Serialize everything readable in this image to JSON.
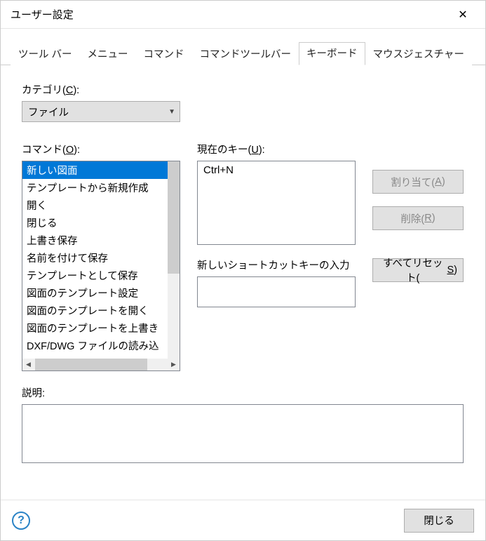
{
  "window": {
    "title": "ユーザー設定"
  },
  "tabs": {
    "t0": "ツール バー",
    "t1": "メニュー",
    "t2": "コマンド",
    "t3": "コマンドツールバー",
    "t4": "キーボード",
    "t5": "マウスジェスチャー"
  },
  "labels": {
    "category_pre": "カテゴリ(",
    "category_key": "C",
    "category_post": "):",
    "commands_pre": "コマンド(",
    "commands_key": "O",
    "commands_post": "):",
    "currentkey_pre": "現在のキー(",
    "currentkey_key": "U",
    "currentkey_post": "):",
    "newshortcut": "新しいショートカットキーの入力",
    "description": "説明:"
  },
  "category": {
    "selected": "ファイル"
  },
  "commands": {
    "items": [
      "新しい図面",
      "テンプレートから新規作成",
      "開く",
      "閉じる",
      "上書き保存",
      "名前を付けて保存",
      "テンプレートとして保存",
      "図面のテンプレート設定",
      "図面のテンプレートを開く",
      "図面のテンプレートを上書き",
      "DXF/DWG ファイルの読み込"
    ],
    "selected_index": 0
  },
  "current_key": "Ctrl+N",
  "buttons": {
    "assign_pre": "割り当て(",
    "assign_key": "A",
    "assign_post": ")",
    "remove_pre": "削除(",
    "remove_key": "R",
    "remove_post": ")",
    "resetall_pre": "すべてリセット(",
    "resetall_key": "S",
    "resetall_post": ")",
    "close": "閉じる"
  }
}
